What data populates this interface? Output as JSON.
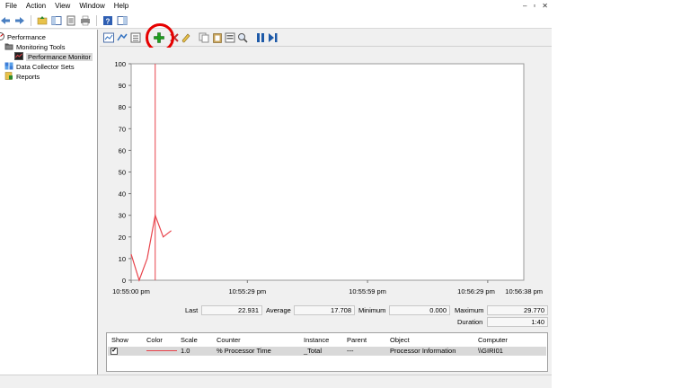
{
  "menu": [
    "File",
    "Action",
    "View",
    "Window",
    "Help"
  ],
  "window_controls": [
    "–",
    "▫",
    "✕"
  ],
  "tree": {
    "root": "Performance",
    "monitoring_tools": "Monitoring Tools",
    "performance_monitor": "Performance Monitor",
    "data_collector_sets": "Data Collector Sets",
    "reports": "Reports"
  },
  "colors": {
    "accent_red": "#e60000",
    "series_line": "#e8434b",
    "time_bar": "#e8434b",
    "add_green": "#1e9e1e",
    "pause_blue": "#1e5aa8"
  },
  "pane_toolbar_icons": [
    "view-graph-icon",
    "freeze-display-icon",
    "view-report-icon",
    "add-counter-icon",
    "delete-counter-icon",
    "highlight-icon",
    "copy-properties-icon",
    "paste-counter-list-icon",
    "properties-icon",
    "zoom-icon",
    "pause-icon",
    "update-data-icon"
  ],
  "chart_data": {
    "type": "line",
    "title": "",
    "xlabel": "",
    "ylabel": "",
    "ylim": [
      0,
      100
    ],
    "y_ticks": [
      "100",
      "90",
      "80",
      "70",
      "60",
      "50",
      "40",
      "30",
      "20",
      "10",
      "0"
    ],
    "x_tick_labels": [
      "10:55:00 pm",
      "10:55:29 pm",
      "10:55:59 pm",
      "10:56:29 pm",
      "10:56:38 pm"
    ],
    "x_range": [
      0,
      98
    ],
    "x_ticks": [
      0,
      29,
      59,
      89
    ],
    "current_time_marker": 6,
    "grid": false,
    "series": [
      {
        "x": [
          0,
          2,
          4,
          6,
          8,
          10
        ],
        "values": [
          12,
          0,
          10,
          30,
          20,
          22.9
        ]
      }
    ]
  },
  "stats": {
    "last_label": "Last",
    "last_value": "22.931",
    "average_label": "Average",
    "average_value": "17.708",
    "minimum_label": "Minimum",
    "minimum_value": "0.000",
    "maximum_label": "Maximum",
    "maximum_value": "29.770",
    "duration_label": "Duration",
    "duration_value": "1:40"
  },
  "counter_table": {
    "headers": [
      "Show",
      "Color",
      "Scale",
      "Counter",
      "Instance",
      "Parent",
      "Object",
      "Computer"
    ],
    "rows": [
      {
        "show": "✔",
        "scale": "1.0",
        "counter": "% Processor Time",
        "instance": "_Total",
        "parent": "---",
        "object": "Processor Information",
        "computer": "\\\\GIRI01"
      }
    ]
  }
}
